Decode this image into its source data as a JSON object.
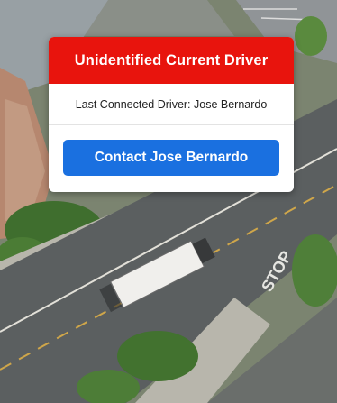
{
  "map": {
    "road_marking_text": "STOP"
  },
  "alert_card": {
    "title": "Unidentified Current Driver",
    "info_text": "Last Connected Driver: Jose Bernardo",
    "contact_button_label": "Contact Jose Bernardo"
  },
  "colors": {
    "header_red": "#e8140d",
    "button_blue": "#1a70e0"
  }
}
